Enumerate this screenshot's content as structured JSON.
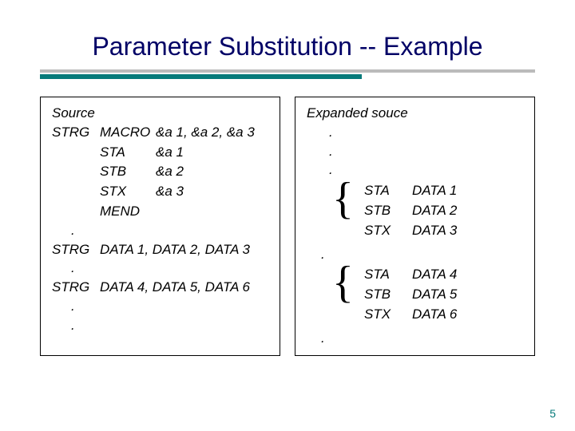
{
  "title": "Parameter Substitution -- Example",
  "pageNumber": "5",
  "left": {
    "header": "Source",
    "r0": {
      "label": "STRG",
      "op": "MACRO",
      "args": "&a 1, &a 2, &a 3"
    },
    "r1": {
      "op": "STA",
      "args": "&a 1"
    },
    "r2": {
      "op": "STB",
      "args": "&a 2"
    },
    "r3": {
      "op": "STX",
      "args": "&a 3"
    },
    "r4": {
      "op": "MEND"
    },
    "d1": ".",
    "r5": {
      "label": "STRG",
      "args": "DATA 1, DATA 2, DATA 3"
    },
    "d2": ".",
    "r6": {
      "label": "STRG",
      "args": "DATA 4, DATA 5, DATA 6"
    },
    "d3": ".",
    "d4": "."
  },
  "right": {
    "header": "Expanded souce",
    "d1": ".",
    "d2": ".",
    "d3": ".",
    "block1": {
      "r0": {
        "op": "STA",
        "val": "DATA 1"
      },
      "r1": {
        "op": "STB",
        "val": "DATA 2"
      },
      "r2": {
        "op": "STX",
        "val": "DATA 3"
      }
    },
    "d4": ".",
    "block2": {
      "r0": {
        "op": "STA",
        "val": "DATA 4"
      },
      "r1": {
        "op": "STB",
        "val": "DATA 5"
      },
      "r2": {
        "op": "STX",
        "val": "DATA 6"
      }
    },
    "d5": "."
  }
}
